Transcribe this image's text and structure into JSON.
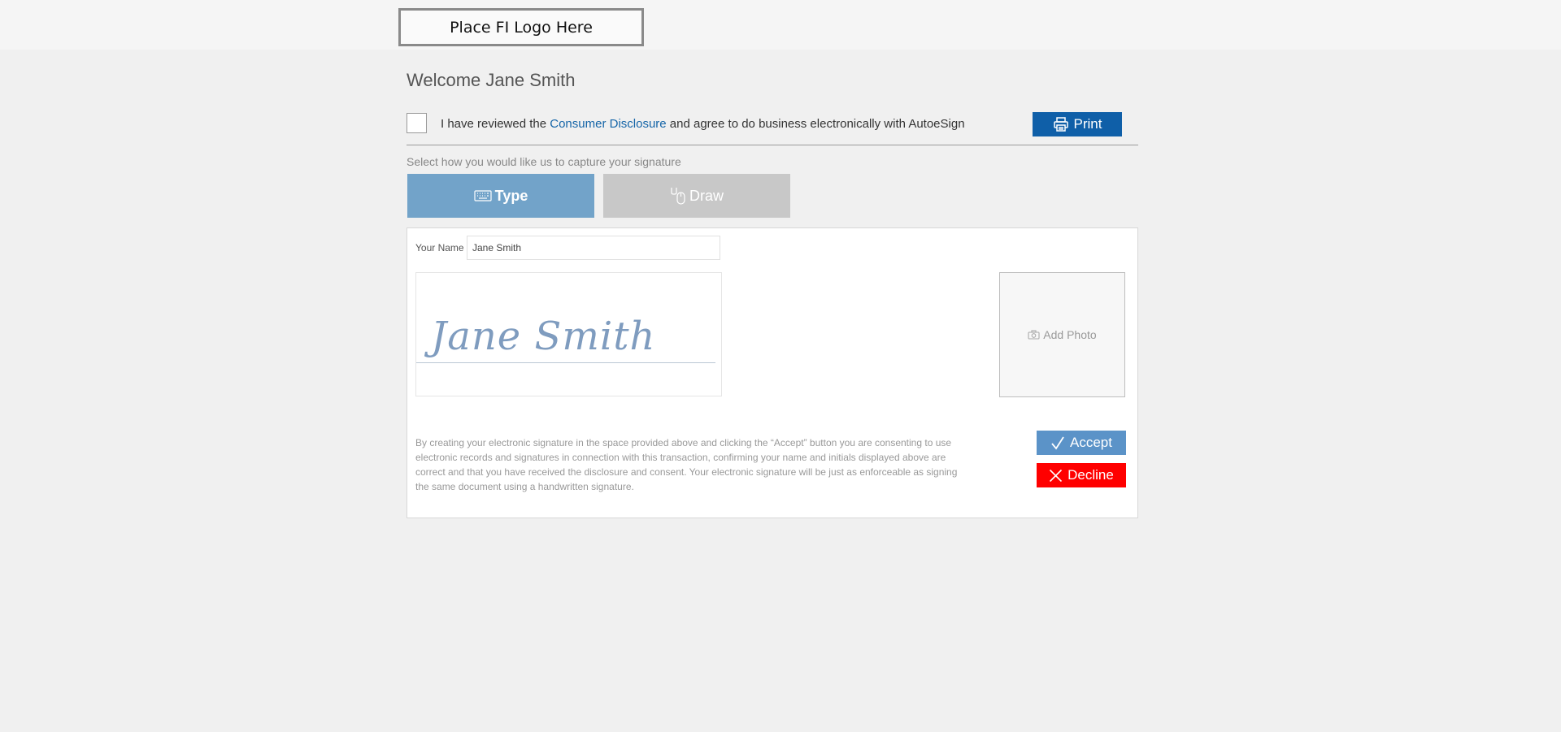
{
  "header": {
    "logo_placeholder": "Place FI Logo Here"
  },
  "welcome": {
    "title": "Welcome Jane Smith"
  },
  "disclosure": {
    "prefix": "I have reviewed the ",
    "link_text": "Consumer Disclosure",
    "suffix": " and agree to do business electronically with AutoeSign",
    "checked": false
  },
  "print": {
    "label": "Print",
    "icon": "printer-icon"
  },
  "capture": {
    "label": "Select how you would like us to capture your signature",
    "tabs": [
      {
        "label": "Type",
        "icon": "keyboard-icon",
        "active": true
      },
      {
        "label": "Draw",
        "icon": "mouse-icon",
        "active": false
      }
    ]
  },
  "form": {
    "name_label": "Your Name",
    "name_value": "Jane Smith",
    "signature_preview": "Jane Smith"
  },
  "photo": {
    "label": "Add Photo",
    "icon": "camera-icon"
  },
  "consent_text": "By creating your electronic signature in the space provided above and clicking the “Accept” button you are consenting to use electronic records and signatures in connection with this transaction, confirming your name and initials displayed above are correct and that you have received the disclosure and consent. Your electronic signature will be just as enforceable as signing the same document using a handwritten signature.",
  "actions": {
    "accept_label": "Accept",
    "decline_label": "Decline"
  },
  "colors": {
    "print_button": "#0f5fa8",
    "type_tab": "#72a3c9",
    "draw_tab": "#c8c8c8",
    "accept_button": "#5b93c8",
    "decline_button": "#ff0000",
    "link": "#1565a8"
  }
}
